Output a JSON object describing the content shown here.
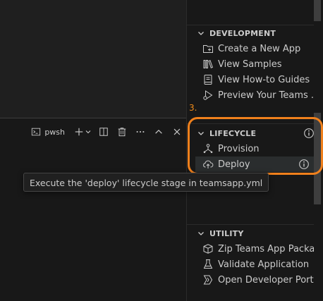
{
  "terminal": {
    "shell_label": "pwsh"
  },
  "tooltip": {
    "text": "Execute the 'deploy' lifecycle stage in teamsapp.yml"
  },
  "sidebar": {
    "development": {
      "title": "DEVELOPMENT",
      "items": [
        {
          "label": "Create a New App",
          "icon": "new-folder-icon"
        },
        {
          "label": "View Samples",
          "icon": "library-icon"
        },
        {
          "label": "View How-to Guides",
          "icon": "book-icon"
        },
        {
          "label": "Preview Your Teams ...",
          "icon": "debug-icon"
        }
      ]
    },
    "step_marker": "3.",
    "lifecycle": {
      "title": "LIFECYCLE",
      "items": [
        {
          "label": "Provision",
          "icon": "provision-icon"
        },
        {
          "label": "Deploy",
          "icon": "cloud-upload-icon"
        }
      ]
    },
    "utility": {
      "title": "UTILITY",
      "items": [
        {
          "label": "Zip Teams App Packa...",
          "icon": "package-icon"
        },
        {
          "label": "Validate Application",
          "icon": "beaker-icon"
        },
        {
          "label": "Open Developer Port...",
          "icon": "portal-icon"
        }
      ]
    }
  },
  "colors": {
    "highlight": "#f0801c",
    "step_marker": "#f08c1a",
    "background": "#181818"
  }
}
